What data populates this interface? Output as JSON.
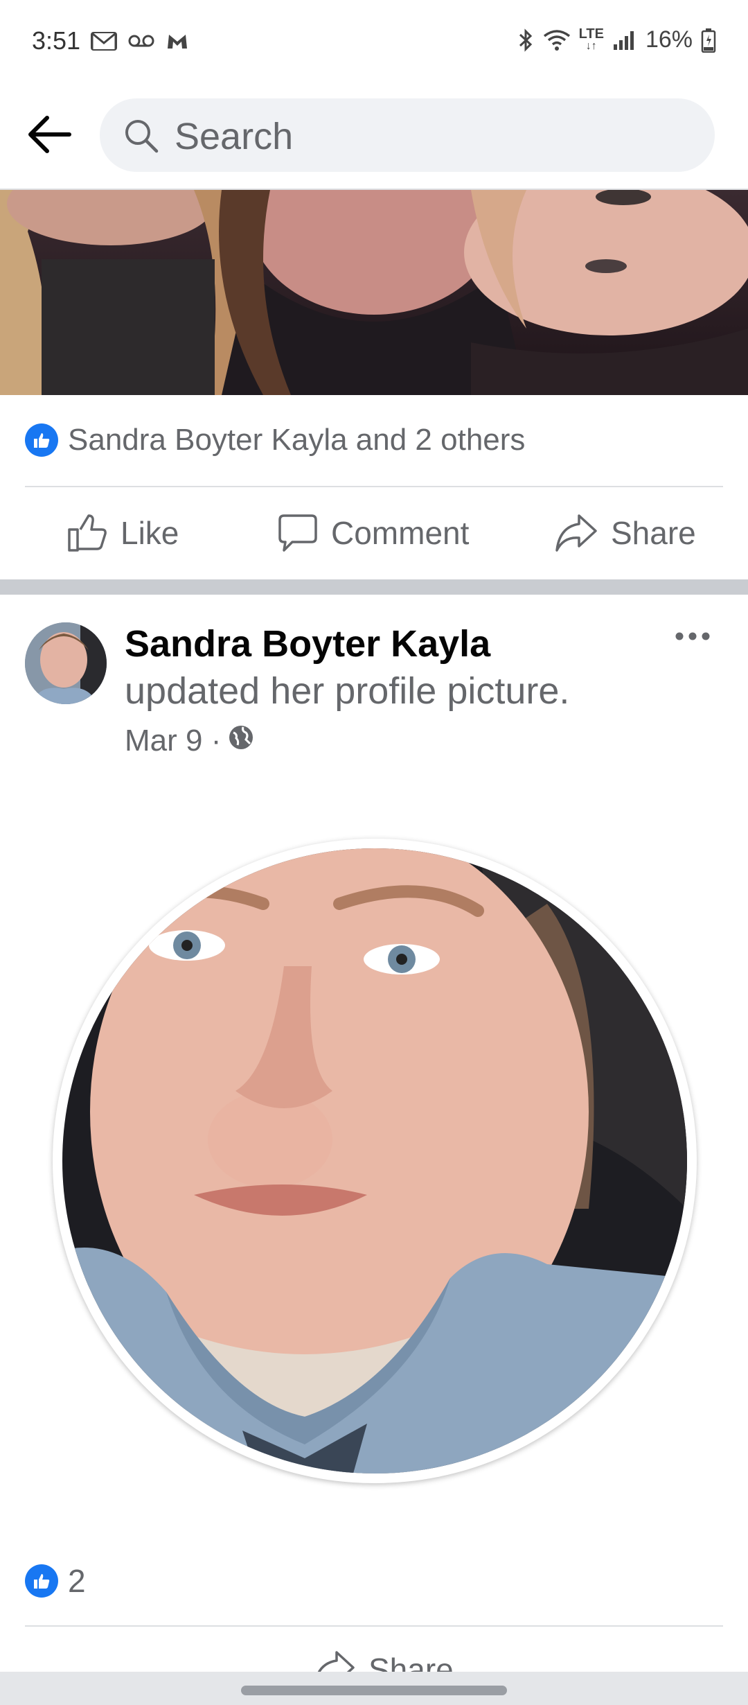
{
  "status_bar": {
    "time": "3:51",
    "left_icons": [
      "gmail-icon",
      "voicemail-icon",
      "malwarebytes-icon"
    ],
    "right_icons": [
      "bluetooth-icon",
      "wifi-icon",
      "lte-icon",
      "signal-icon",
      "battery-icon"
    ],
    "lte_label": "LTE",
    "battery": "16%"
  },
  "header": {
    "back_icon": "arrow-left-icon",
    "search_placeholder": "Search"
  },
  "post1": {
    "reactions_text": "Sandra Boyter Kayla and 2 others",
    "actions": {
      "like": "Like",
      "comment": "Comment",
      "share": "Share"
    }
  },
  "post2": {
    "author": "Sandra Boyter Kayla",
    "action": "updated her profile picture.",
    "date": "Mar 9 ·",
    "privacy_icon": "globe-icon",
    "reactions_count": "2",
    "share": "Share"
  },
  "colors": {
    "accent": "#1877f2",
    "secondary_text": "#65676b",
    "divider": "#dddfe2"
  }
}
